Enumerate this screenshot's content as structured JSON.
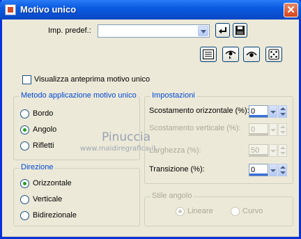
{
  "window": {
    "title": "Motivo unico",
    "close_glyph": "✕"
  },
  "preset": {
    "label": "Imp. predef.:",
    "value": ""
  },
  "preview_checkbox": {
    "label": "Visualizza anteprima motivo unico",
    "checked": false
  },
  "metodo": {
    "title": "Metodo applicazione motivo unico",
    "options": [
      {
        "label": "Bordo",
        "checked": false
      },
      {
        "label": "Angolo",
        "checked": true
      },
      {
        "label": "Rifletti",
        "checked": false
      }
    ]
  },
  "direzione": {
    "title": "Direzione",
    "options": [
      {
        "label": "Orizzontale",
        "checked": true
      },
      {
        "label": "Verticale",
        "checked": false
      },
      {
        "label": "Bidirezionale",
        "checked": false
      }
    ]
  },
  "impostazioni": {
    "title": "Impostazioni",
    "fields": [
      {
        "label": "Scostamento orizzontale (%):",
        "value": "0",
        "enabled": true
      },
      {
        "label": "Scostamento verticale (%):",
        "value": "0",
        "enabled": false
      },
      {
        "label": "Larghezza (%):",
        "value": "50",
        "enabled": false
      },
      {
        "label": "Transizione (%):",
        "value": "0",
        "enabled": true
      }
    ]
  },
  "stile_angolo": {
    "title": "Stile angolo",
    "options": [
      {
        "label": "Lineare",
        "checked": true
      },
      {
        "label": "Curvo",
        "checked": false
      }
    ]
  },
  "watermark": {
    "line1": "Pinuccia",
    "line2": "www.maidiregrafica.it"
  },
  "icons": {
    "app": "app-window-icon",
    "reset": "reset-arrow-icon",
    "save": "save-disk-icon",
    "toolbar": [
      "list-icon",
      "eye-mouse-icon",
      "eye-icon",
      "dice-icon"
    ]
  },
  "colors": {
    "titlebar": "#0a5be1",
    "group_title": "#0046d5",
    "disabled_text": "#aca899",
    "radio_checked": "#21a121"
  }
}
